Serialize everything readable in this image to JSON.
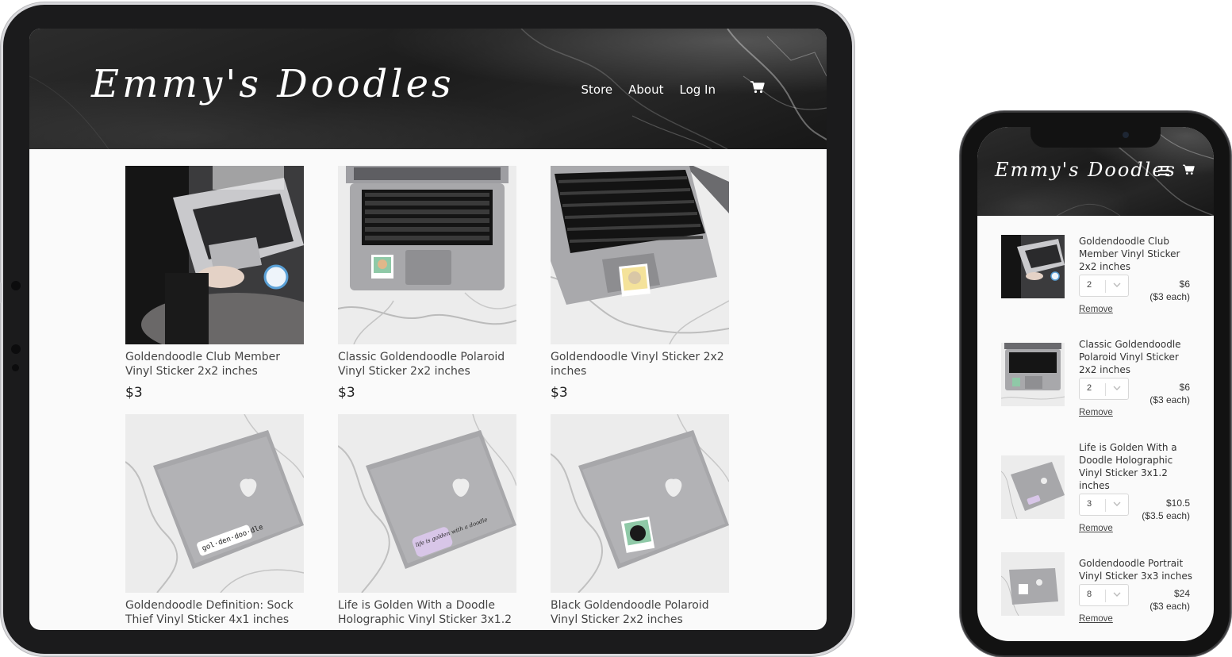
{
  "brand": {
    "logo_text": "Emmy's Doodles"
  },
  "tablet": {
    "nav": {
      "store": "Store",
      "about": "About",
      "login": "Log In"
    },
    "products": [
      {
        "title": "Goldendoodle Club Member Vinyl Sticker 2x2 inches",
        "price": "$3",
        "image": "laptop-lap-sticker"
      },
      {
        "title": "Classic Goldendoodle Polaroid Vinyl Sticker 2x2 inches",
        "price": "$3",
        "image": "laptop-open-polaroid"
      },
      {
        "title": "Goldendoodle Vinyl Sticker 2x2 inches",
        "price": "$3",
        "image": "laptop-open-yellow"
      },
      {
        "title": "Goldendoodle Definition: Sock Thief Vinyl Sticker 4x1 inches",
        "price": "",
        "image": "laptop-closed-definition",
        "sticker_text": "gol·den·doo·dle"
      },
      {
        "title": "Life is Golden With a Doodle Holographic Vinyl Sticker 3x1.2",
        "price": "",
        "image": "laptop-closed-holo",
        "sticker_text": "life is golden with a doodle"
      },
      {
        "title": "Black Goldendoodle Polaroid Vinyl Sticker 2x2 inches",
        "price": "",
        "image": "laptop-closed-black"
      }
    ]
  },
  "phone": {
    "cart_items": [
      {
        "title": "Goldendoodle Club Member Vinyl Sticker 2x2 inches",
        "qty": "2",
        "total": "$6",
        "each": "($3 each)",
        "remove": "Remove"
      },
      {
        "title": "Classic Goldendoodle Polaroid Vinyl Sticker 2x2 inches",
        "qty": "2",
        "total": "$6",
        "each": "($3 each)",
        "remove": "Remove"
      },
      {
        "title": "Life is Golden With a Doodle Holographic Vinyl Sticker 3x1.2 inches",
        "qty": "3",
        "total": "$10.5",
        "each": "($3.5 each)",
        "remove": "Remove"
      },
      {
        "title": "Goldendoodle Portrait Vinyl Sticker 3x3 inches",
        "qty": "8",
        "total": "$24",
        "each": "($3 each)",
        "remove": "Remove"
      }
    ]
  },
  "colors": {
    "header_dark": "#1f1f1f",
    "page_bg": "#fafafa",
    "text": "#444444",
    "device_frame": "#1b1b1c"
  },
  "icons": [
    "cart-icon",
    "hamburger-menu-icon",
    "chevron-down-icon"
  ]
}
